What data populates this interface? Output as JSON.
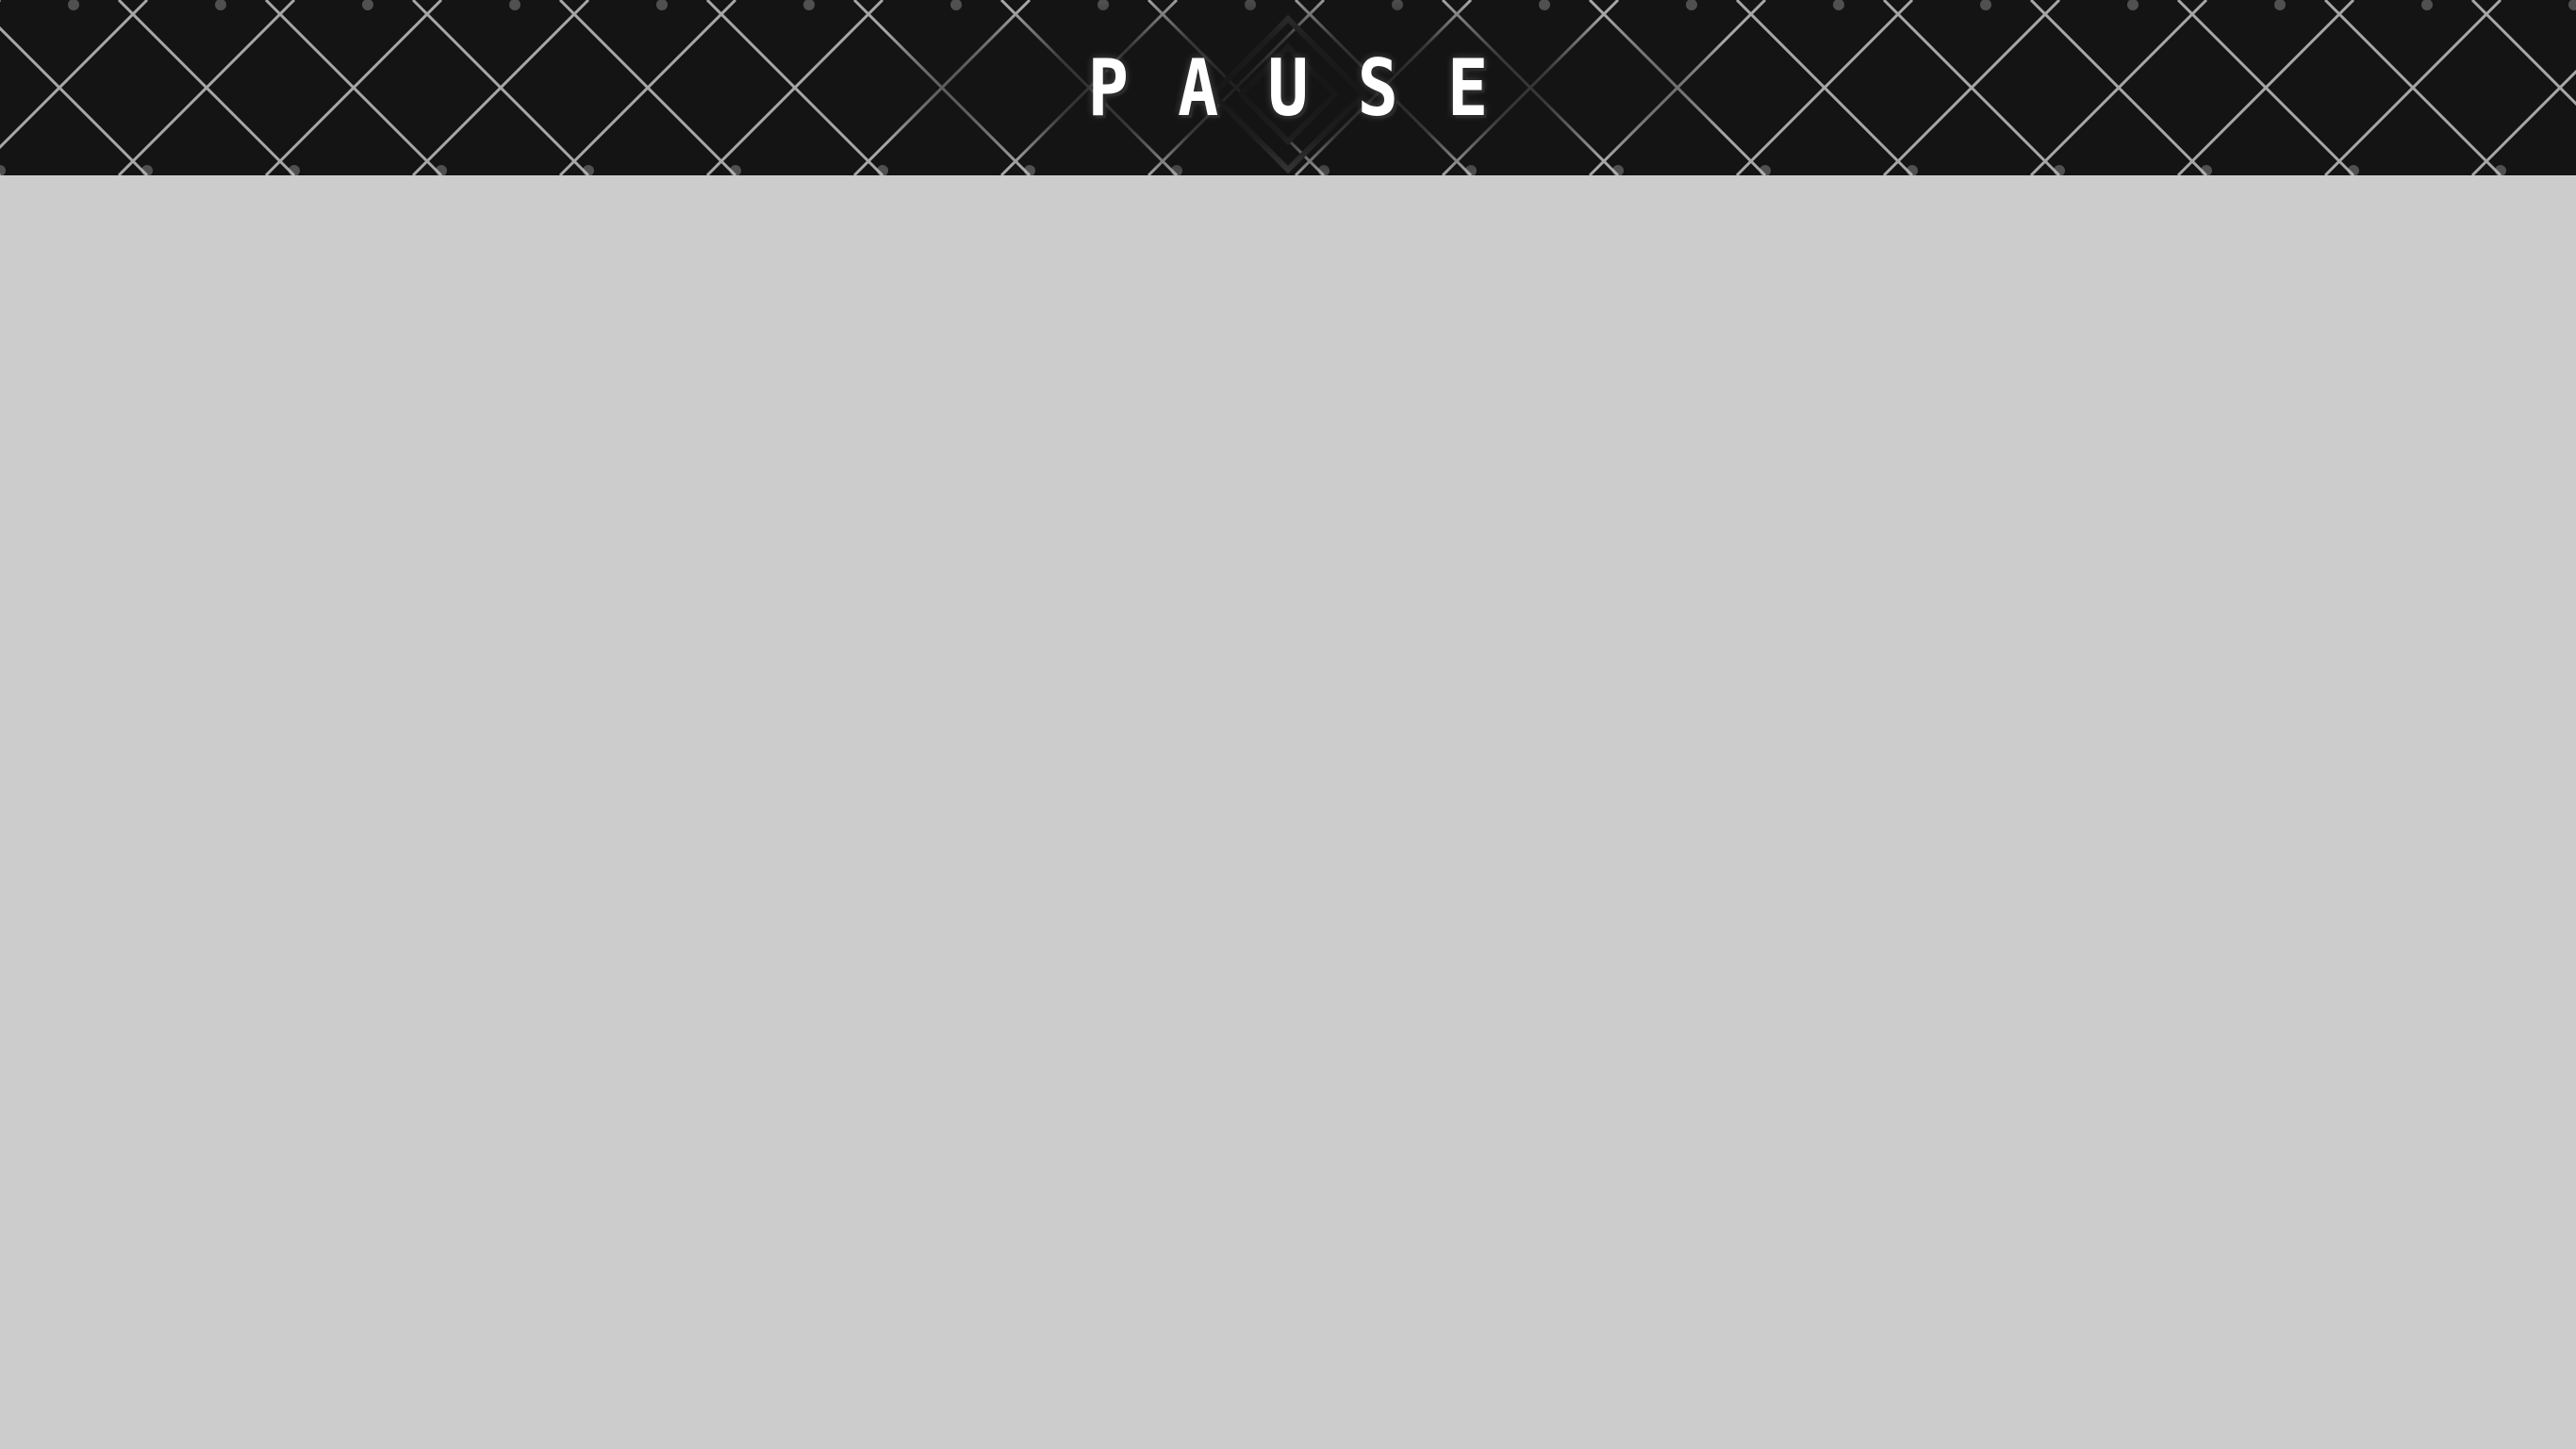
{
  "header": {
    "title": "PAUSE"
  },
  "colors": {
    "header_background": "#141414",
    "pattern_line": "#d9d9d9",
    "title_text": "#ffffff",
    "content_background": "#cccccc"
  },
  "icons": {
    "header_pattern": "diamond-lattice-pattern"
  }
}
